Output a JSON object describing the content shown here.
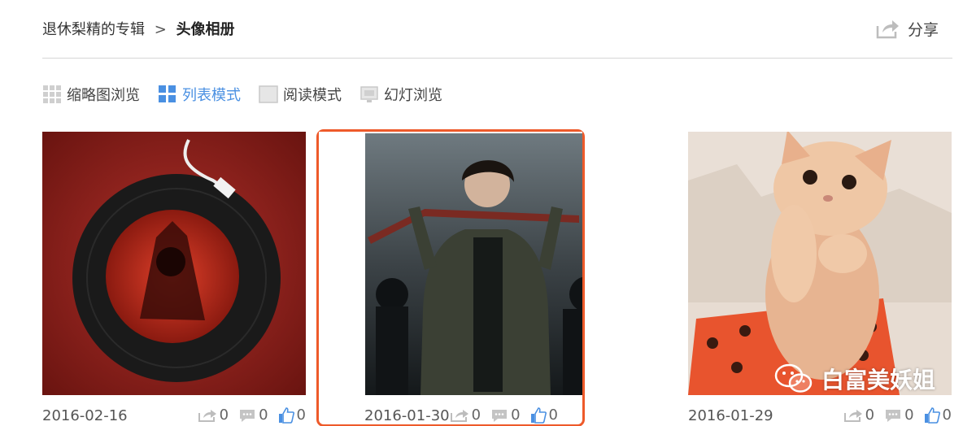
{
  "breadcrumb": {
    "parent": "退休梨精的专辑",
    "separator": ">",
    "current": "头像相册"
  },
  "share": {
    "label": "分享",
    "icon": "share-icon"
  },
  "view_modes": [
    {
      "label": "缩略图浏览",
      "icon": "thumbnail-grid-icon",
      "active": false
    },
    {
      "label": "列表模式",
      "icon": "list-grid-icon",
      "active": true
    },
    {
      "label": "阅读模式",
      "icon": "reading-icon",
      "active": false
    },
    {
      "label": "幻灯浏览",
      "icon": "slideshow-icon",
      "active": false
    }
  ],
  "photos": [
    {
      "date": "2016-02-16",
      "shares": "0",
      "comments": "0",
      "likes": "0",
      "subject": "vinyl record artwork",
      "selected": false
    },
    {
      "date": "2016-01-30",
      "shares": "0",
      "comments": "0",
      "likes": "0",
      "subject": "performer holding bat on stage",
      "selected": true
    },
    {
      "date": "2016-01-29",
      "shares": "0",
      "comments": "0",
      "likes": "0",
      "subject": "orange kitten",
      "selected": false
    }
  ],
  "watermark": {
    "text": "白富美妖姐",
    "icon": "wechat-icon"
  },
  "colors": {
    "accent_blue": "#4a90e2",
    "selection_border": "#ee5a2a",
    "divider": "#d6d6d6"
  }
}
